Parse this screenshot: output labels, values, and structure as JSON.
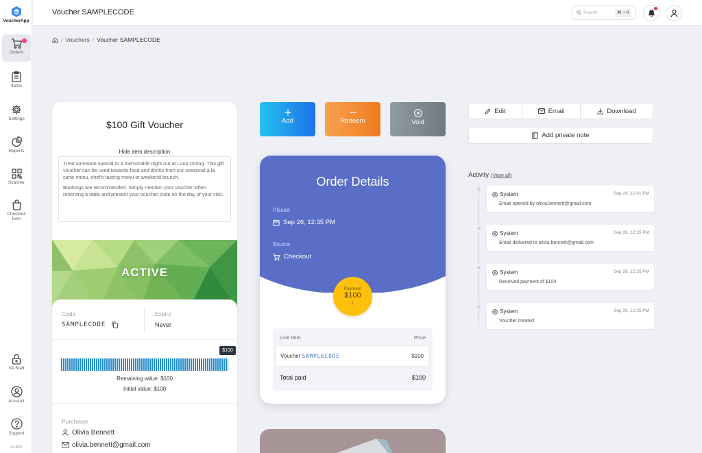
{
  "app": {
    "logo_text": "VoucherApp",
    "version": "v3.823"
  },
  "sidebar": {
    "items": [
      {
        "label": "Orders",
        "icon": "cart-icon"
      },
      {
        "label": "Items",
        "icon": "clipboard-icon"
      },
      {
        "label": "Settings",
        "icon": "gear-icon"
      },
      {
        "label": "Reports",
        "icon": "pie-chart-icon"
      },
      {
        "label": "Scanner",
        "icon": "qr-code-icon"
      },
      {
        "label": "Checkout form",
        "icon": "shopping-bag-icon"
      }
    ],
    "bottom_items": [
      {
        "label": "VA Staff",
        "icon": "lock-icon"
      },
      {
        "label": "Account",
        "icon": "user-circle-icon"
      },
      {
        "label": "Support",
        "icon": "help-circle-icon"
      }
    ]
  },
  "header": {
    "title": "Voucher SAMPLECODE",
    "search_placeholder": "Search",
    "shortcut": "⌘ + K"
  },
  "breadcrumb": {
    "items": [
      "Vouchers",
      "Voucher SAMPLECODE"
    ]
  },
  "voucher": {
    "title": "$100 Gift Voucher",
    "hide_description": "Hide item description",
    "description": [
      "Treat someone special to a memorable night out at Luna Dining. This gift voucher can be used towards food and drinks from our seasonal à la carte menu, chef's tasting menu or weekend brunch.",
      "Bookings are recommended. Simply mention your voucher when reserving a table and present your voucher code on the day of your visit."
    ],
    "status": "ACTIVE",
    "code_label": "Code",
    "code": "SAMPLECODE",
    "expiry_label": "Expiry",
    "expiry": "Never",
    "balance_badge": "$100",
    "balance_fraction": 1.0,
    "remaining": "Remaining value: $100",
    "initial": "Initial value: $100",
    "purchaser_label": "Purchaser",
    "purchaser_name": "Olivia Bennett",
    "purchaser_email": "olivia.bennett@gmail.com"
  },
  "actions": {
    "add": "Add",
    "redeem": "Redeem",
    "void": "Void"
  },
  "order": {
    "title": "Order Details",
    "placed_label": "Placed",
    "placed": "Sep 26, 12:35 PM",
    "source_label": "Source",
    "source": "Checkout",
    "payment_label": "Payment",
    "payment_amount": "$100",
    "line_item_header": "Line Item",
    "price_header": "Price",
    "line_item_prefix": "Voucher",
    "line_item_code": "SAMPLECODE",
    "line_item_price": "$100",
    "total_label": "Total paid",
    "total": "$100"
  },
  "toolbar": {
    "edit": "Edit",
    "email": "Email",
    "download": "Download",
    "add_note": "Add private note"
  },
  "activity": {
    "title": "Activity",
    "view_all": "(View all)",
    "items": [
      {
        "who": "System",
        "time": "Sep 26, 12:41 PM",
        "msg": "Email opened by olivia.bennett@gmail.com"
      },
      {
        "who": "System",
        "time": "Sep 26, 12:35 PM",
        "msg": "Email delivered to olivia.bennett@gmail.com"
      },
      {
        "who": "System",
        "time": "Sep 26, 12:35 PM",
        "msg": "Received payment of $100"
      },
      {
        "who": "System",
        "time": "Sep 26, 12:35 PM",
        "msg": "Voucher created"
      }
    ]
  },
  "colors": {
    "accent": "#5a6ec7",
    "payment": "#fdc10c",
    "notification": "#ff3d7f"
  }
}
